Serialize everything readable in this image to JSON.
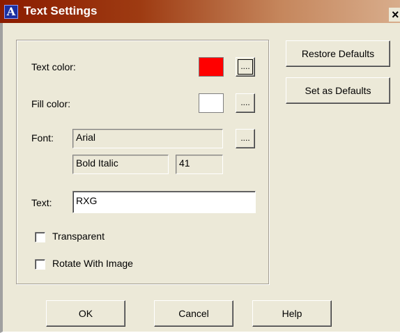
{
  "window": {
    "title": "Text Settings",
    "app_icon": "A",
    "close_label": "×"
  },
  "settings": {
    "text_color_label": "Text color:",
    "text_color_value": "#ff0000",
    "fill_color_label": "Fill color:",
    "fill_color_value": "#ffffff",
    "browse_label": "....",
    "font_label": "Font:",
    "font_name": "Arial",
    "font_style": "Bold Italic",
    "font_size": "41",
    "text_label": "Text:",
    "text_value": "RXG",
    "transparent_label": "Transparent",
    "transparent_checked": false,
    "rotate_label": "Rotate With Image",
    "rotate_checked": false
  },
  "side_buttons": {
    "restore_defaults": "Restore Defaults",
    "set_as_defaults": "Set as Defaults"
  },
  "footer": {
    "ok": "OK",
    "cancel": "Cancel",
    "help": "Help"
  }
}
